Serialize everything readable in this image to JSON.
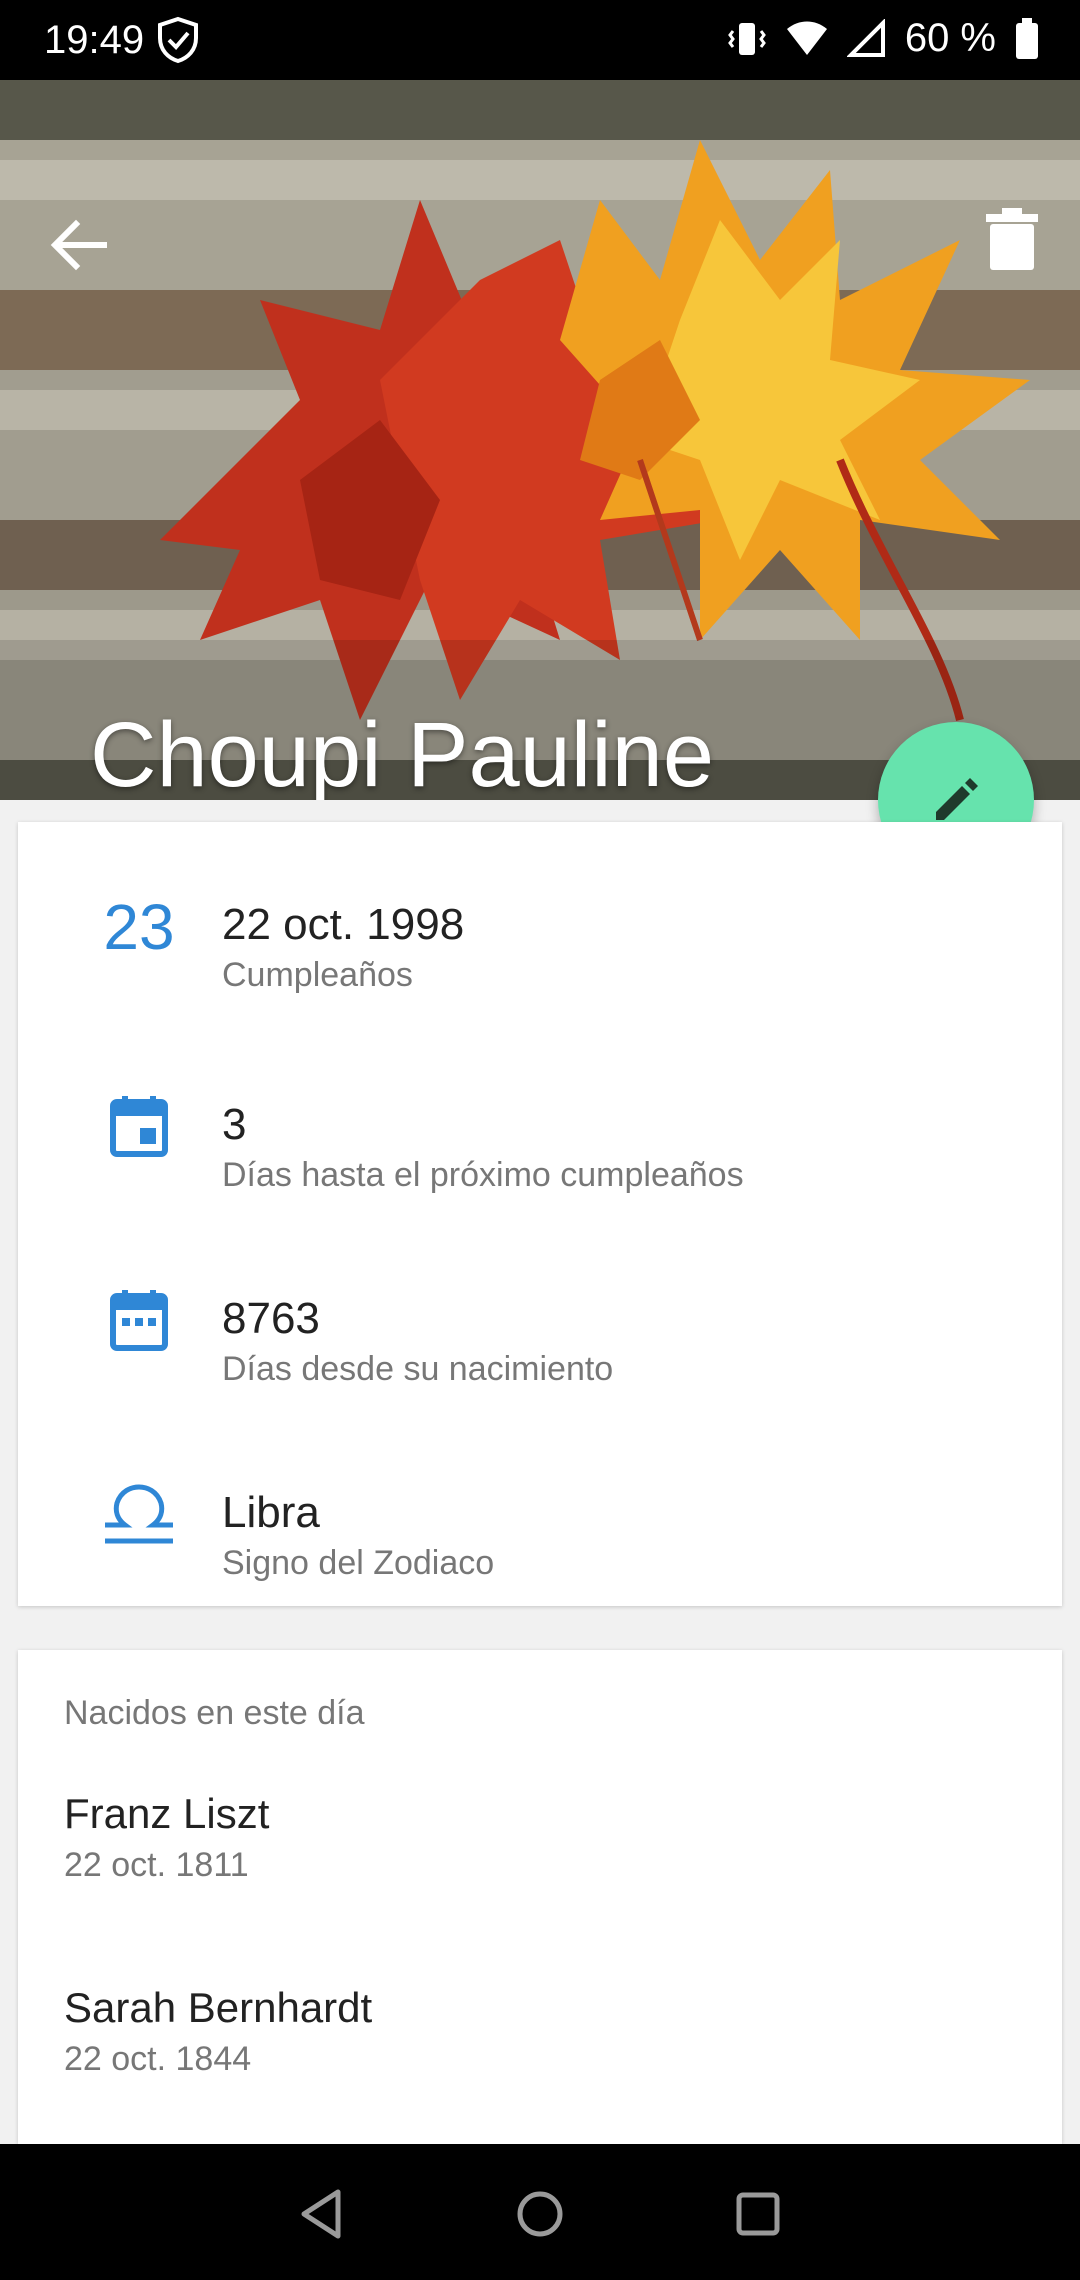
{
  "status_bar": {
    "time": "19:49",
    "battery": "60 %",
    "icons": [
      "shield-icon",
      "vibrate-icon",
      "wifi-icon",
      "signal-icon",
      "battery-icon"
    ]
  },
  "header": {
    "title": "Choupi Pauline",
    "back_icon": "arrow-back-icon",
    "delete_icon": "trash-icon"
  },
  "fab": {
    "icon": "pencil-icon",
    "color": "#66e3ad"
  },
  "details": [
    {
      "icon": "23",
      "primary": "22 oct. 1998",
      "secondary": "Cumpleaños"
    },
    {
      "icon": "calendar-event-icon",
      "primary": "3",
      "secondary": "Días hasta el próximo cumpleaños"
    },
    {
      "icon": "calendar-grid-icon",
      "primary": "8763",
      "secondary": "Días desde su nacimiento"
    },
    {
      "icon": "libra-icon",
      "primary": "Libra",
      "secondary": "Signo del Zodiaco"
    }
  ],
  "born_today": {
    "header": "Nacidos en este día",
    "people": [
      {
        "name": "Franz Liszt",
        "date": "22 oct. 1811"
      },
      {
        "name": "Sarah Bernhardt",
        "date": "22 oct. 1844"
      }
    ]
  },
  "nav_bar": {
    "icons": [
      "back-triangle-icon",
      "home-circle-icon",
      "recents-square-icon"
    ]
  },
  "colors": {
    "accent": "#2f87d6",
    "fab": "#66e3ad"
  }
}
